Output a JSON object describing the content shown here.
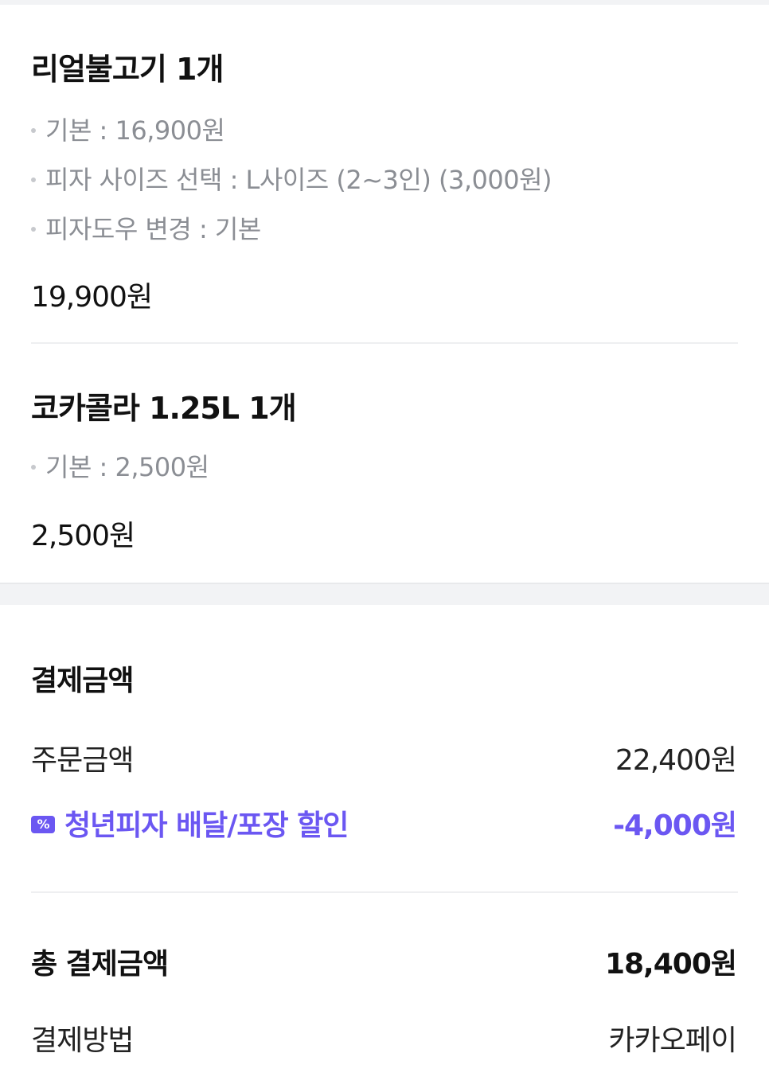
{
  "orders": [
    {
      "name": "리얼불고기 1개",
      "options": [
        "기본 : 16,900원",
        "피자 사이즈 선택 : L사이즈 (2~3인) (3,000원)",
        "피자도우 변경 : 기본"
      ],
      "price": "19,900원"
    },
    {
      "name": "코카콜라 1.25L 1개",
      "options": [
        "기본 : 2,500원"
      ],
      "price": "2,500원"
    }
  ],
  "payment": {
    "title": "결제금액",
    "order_amount_label": "주문금액",
    "order_amount_value": "22,400원",
    "discount_icon": "coupon-icon",
    "discount_label": "청년피자 배달/포장 할인",
    "discount_value": "-4,000원",
    "total_label": "총 결제금액",
    "total_value": "18,400원",
    "method_label": "결제방법",
    "method_value": "카카오페이"
  },
  "colors": {
    "accent": "#6b57f2",
    "muted_text": "#8b8e94",
    "section_bg": "#f2f3f5"
  }
}
